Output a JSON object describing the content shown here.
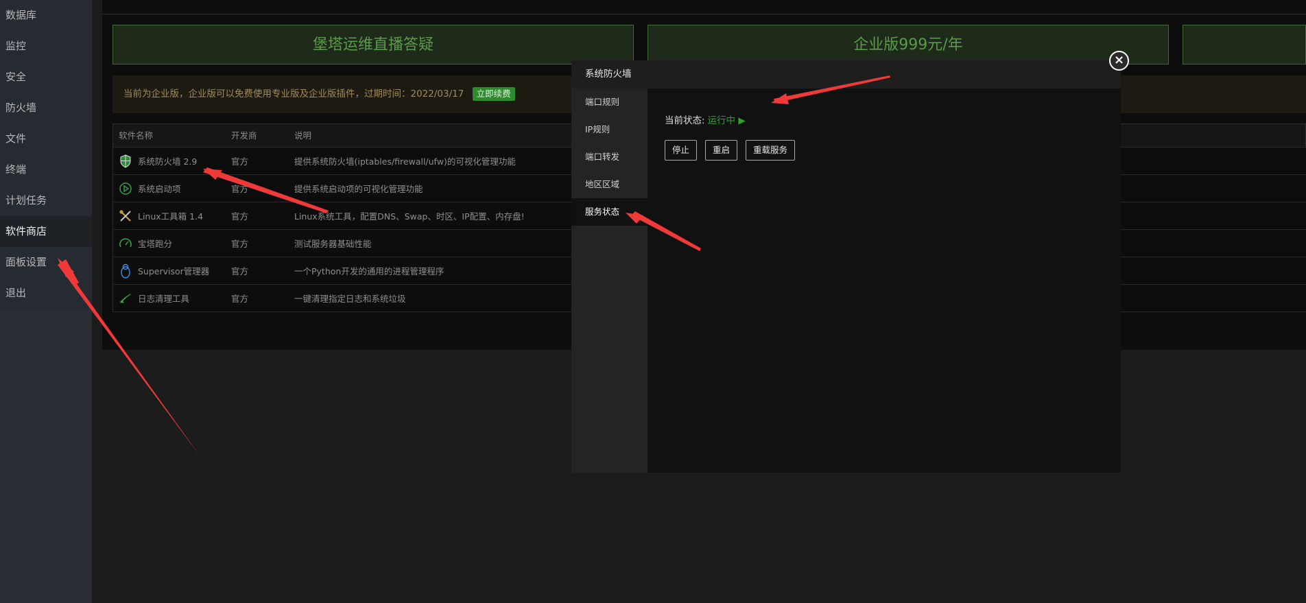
{
  "sidebar": {
    "items": [
      {
        "label": "数据库"
      },
      {
        "label": "监控"
      },
      {
        "label": "安全"
      },
      {
        "label": "防火墙"
      },
      {
        "label": "文件"
      },
      {
        "label": "终端"
      },
      {
        "label": "计划任务"
      },
      {
        "label": "软件商店"
      },
      {
        "label": "面板设置"
      },
      {
        "label": "退出"
      }
    ],
    "active_index": 7
  },
  "banners": [
    {
      "label": "堡塔运维直播答疑"
    },
    {
      "label": "企业版999元/年"
    },
    {
      "label": ""
    }
  ],
  "notice": {
    "text": "当前为企业版，企业版可以免费使用专业版及企业版插件，过期时间：2022/03/17",
    "renew_label": "立即续费"
  },
  "table": {
    "headers": [
      "软件名称",
      "开发商",
      "说明"
    ],
    "rows": [
      {
        "name": "系统防火墙 2.9",
        "vendor": "官方",
        "desc": "提供系统防火墙(iptables/firewall/ufw)的可视化管理功能",
        "icon": "shield-icon"
      },
      {
        "name": "系统启动项",
        "vendor": "官方",
        "desc": "提供系统启动项的可视化管理功能",
        "icon": "play-circle-icon"
      },
      {
        "name": "Linux工具箱 1.4",
        "vendor": "官方",
        "desc": "Linux系统工具，配置DNS、Swap、时区、IP配置、内存盘!",
        "icon": "tools-icon"
      },
      {
        "name": "宝塔跑分",
        "vendor": "官方",
        "desc": "测试服务器基础性能",
        "icon": "gauge-icon"
      },
      {
        "name": "Supervisor管理器",
        "vendor": "官方",
        "desc": "一个Python开发的通用的进程管理程序",
        "icon": "tux-icon"
      },
      {
        "name": "日志清理工具",
        "vendor": "官方",
        "desc": "一键清理指定日志和系统垃圾",
        "icon": "broom-icon"
      }
    ]
  },
  "dialog": {
    "title": "系统防火墙",
    "tabs": [
      {
        "label": "端口规则"
      },
      {
        "label": "IP规则"
      },
      {
        "label": "端口转发"
      },
      {
        "label": "地区区域"
      },
      {
        "label": "服务状态"
      }
    ],
    "active_tab": 4,
    "status_label": "当前状态:",
    "status_value": "运行中 ▶",
    "buttons": [
      {
        "label": "停止"
      },
      {
        "label": "重启"
      },
      {
        "label": "重载服务"
      }
    ]
  },
  "colors": {
    "accent_green": "#2fa12f",
    "annotation_red": "#f03a3a"
  }
}
